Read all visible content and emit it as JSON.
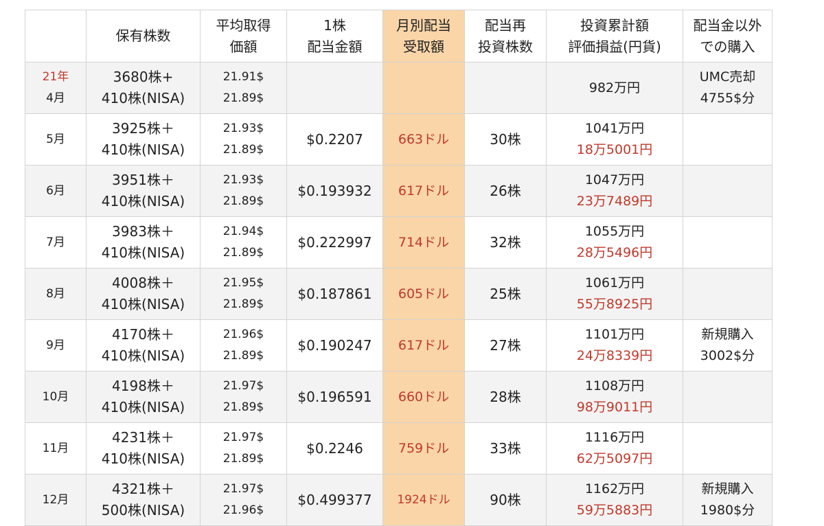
{
  "header": {
    "cols": [
      "",
      [
        "保有株数"
      ],
      [
        "平均取得",
        "価額"
      ],
      [
        "1株",
        "配当金額"
      ],
      [
        "月別配当",
        "受取額"
      ],
      [
        "配当再",
        "投資株数"
      ],
      [
        "投資累計額",
        "評価損益(円貨)"
      ],
      [
        "配当金以外",
        "での購入"
      ]
    ]
  },
  "rows": [
    {
      "month": [
        "21年",
        "4月"
      ],
      "shares": [
        "3680株+",
        "410株(NISA)"
      ],
      "avg": [
        "21.91$",
        "21.89$"
      ],
      "dividend": "",
      "received": "",
      "reinvest": "",
      "invest": [
        "982万円"
      ],
      "other": [
        "UMC売却",
        "4755$分"
      ]
    },
    {
      "month": [
        "5月"
      ],
      "shares": [
        "3925株＋",
        "410株(NISA)"
      ],
      "avg": [
        "21.93$",
        "21.89$"
      ],
      "dividend": "$0.2207",
      "received": "663ドル",
      "reinvest": "30株",
      "invest": [
        "1041万円",
        "18万5001円"
      ],
      "other": []
    },
    {
      "month": [
        "6月"
      ],
      "shares": [
        "3951株＋",
        "410株(NISA)"
      ],
      "avg": [
        "21.93$",
        "21.89$"
      ],
      "dividend": "$0.193932",
      "received": "617ドル",
      "reinvest": "26株",
      "invest": [
        "1047万円",
        "23万7489円"
      ],
      "other": []
    },
    {
      "month": [
        "7月"
      ],
      "shares": [
        "3983株＋",
        "410株(NISA)"
      ],
      "avg": [
        "21.94$",
        "21.89$"
      ],
      "dividend": "$0.222997",
      "received": "714ドル",
      "reinvest": "32株",
      "invest": [
        "1055万円",
        "28万5496円"
      ],
      "other": []
    },
    {
      "month": [
        "8月"
      ],
      "shares": [
        "4008株＋",
        "410株(NISA)"
      ],
      "avg": [
        "21.95$",
        "21.89$"
      ],
      "dividend": "$0.187861",
      "received": "605ドル",
      "reinvest": "25株",
      "invest": [
        "1061万円",
        "55万8925円"
      ],
      "other": []
    },
    {
      "month": [
        "9月"
      ],
      "shares": [
        "4170株＋",
        "410株(NISA)"
      ],
      "avg": [
        "21.96$",
        "21.89$"
      ],
      "dividend": "$0.190247",
      "received": "617ドル",
      "reinvest": "27株",
      "invest": [
        "1101万円",
        "24万8339円"
      ],
      "other": [
        "新規購入",
        "3002$分"
      ]
    },
    {
      "month": [
        "10月"
      ],
      "shares": [
        "4198株＋",
        "410株(NISA)"
      ],
      "avg": [
        "21.97$",
        "21.89$"
      ],
      "dividend": "$0.196591",
      "received": "660ドル",
      "reinvest": "28株",
      "invest": [
        "1108万円",
        "98万9011円"
      ],
      "other": []
    },
    {
      "month": [
        "11月"
      ],
      "shares": [
        "4231株＋",
        "410株(NISA)"
      ],
      "avg": [
        "21.97$",
        "21.89$"
      ],
      "dividend": "$0.2246",
      "received": "759ドル",
      "reinvest": "33株",
      "invest": [
        "1116万円",
        "62万5097円"
      ],
      "other": []
    },
    {
      "month": [
        "12月"
      ],
      "shares": [
        "4321株＋",
        "500株(NISA)"
      ],
      "avg": [
        "21.97$",
        "21.96$"
      ],
      "dividend": "$0.499377",
      "received": "1924ドル",
      "reinvest": "90株",
      "invest": [
        "1162万円",
        "59万5883円"
      ],
      "other": [
        "新規購入",
        "1980$分"
      ]
    }
  ],
  "colors": {
    "accent_red": "#c0392b",
    "highlight_column": "#f9d5a8",
    "grid_line": "#d3d3d3",
    "row_stripe": "#f3f3f3"
  }
}
